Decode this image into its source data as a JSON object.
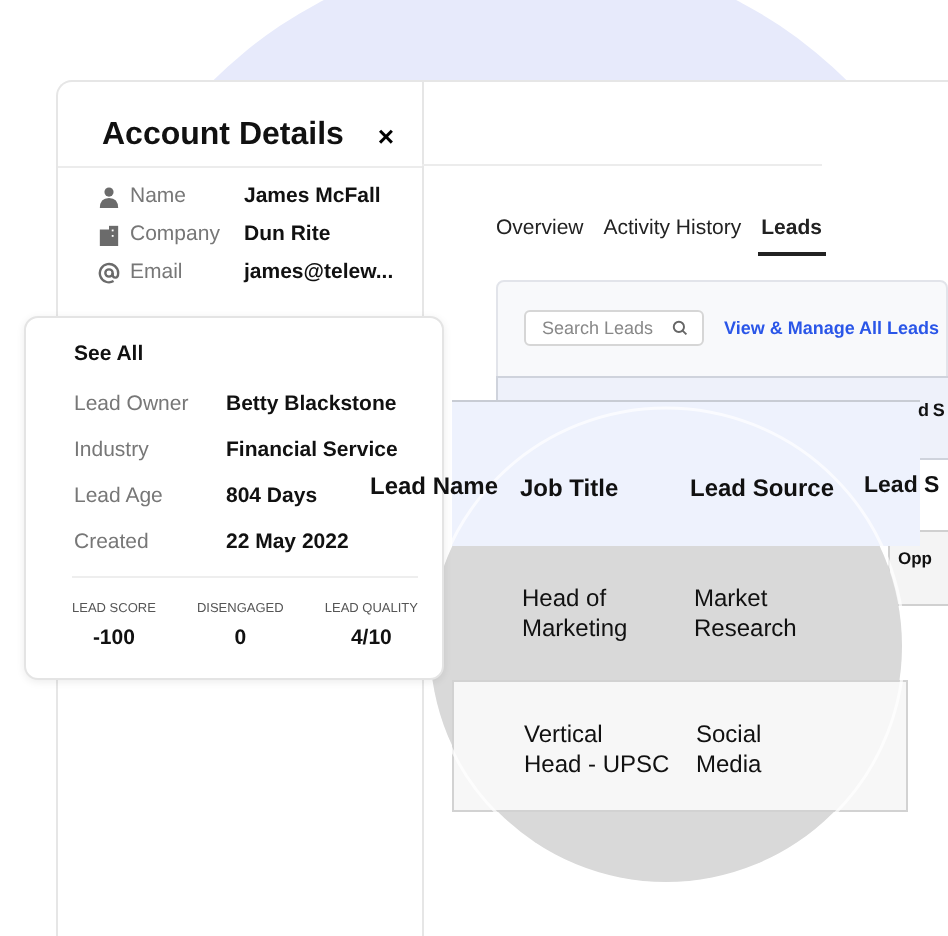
{
  "account": {
    "title": "Account Details",
    "close": "×",
    "fields": [
      {
        "kind": "person",
        "label": "Name",
        "value": "James McFall"
      },
      {
        "kind": "company",
        "label": "Company",
        "value": "Dun Rite"
      },
      {
        "kind": "email",
        "label": "Email",
        "value": "james@telew..."
      }
    ]
  },
  "lead_card": {
    "heading": "See All",
    "fields": [
      {
        "label": "Lead Owner",
        "value": "Betty Blackstone"
      },
      {
        "label": "Industry",
        "value": "Financial Service"
      },
      {
        "label": "Lead Age",
        "value": "804 Days"
      },
      {
        "label": "Created",
        "value": "22 May 2022"
      }
    ],
    "stats": [
      {
        "label": "LEAD SCORE",
        "value": "-100"
      },
      {
        "label": "DISENGAGED",
        "value": "0"
      },
      {
        "label": "LEAD QUALITY",
        "value": "4/10"
      }
    ]
  },
  "tabs": [
    {
      "label": "Overview",
      "selected": false
    },
    {
      "label": "Activity History",
      "selected": false
    },
    {
      "label": "Leads",
      "selected": true
    }
  ],
  "leads_panel": {
    "search": {
      "placeholder": "Search Leads"
    },
    "link": "View & Manage All Leads",
    "back_header_fragment": "d S",
    "back_cell_fragment": "Opp"
  },
  "table": {
    "columns": [
      "Lead Name",
      "Job Title",
      "Lead Source",
      "Lead S"
    ],
    "rows": [
      {
        "job_title": "Head of\nMarketing",
        "lead_source": "Market\nResearch",
        "highlighted": true
      },
      {
        "job_title": "Vertical\nHead - UPSC",
        "lead_source": "Social\nMedia",
        "highlighted": false
      }
    ]
  }
}
